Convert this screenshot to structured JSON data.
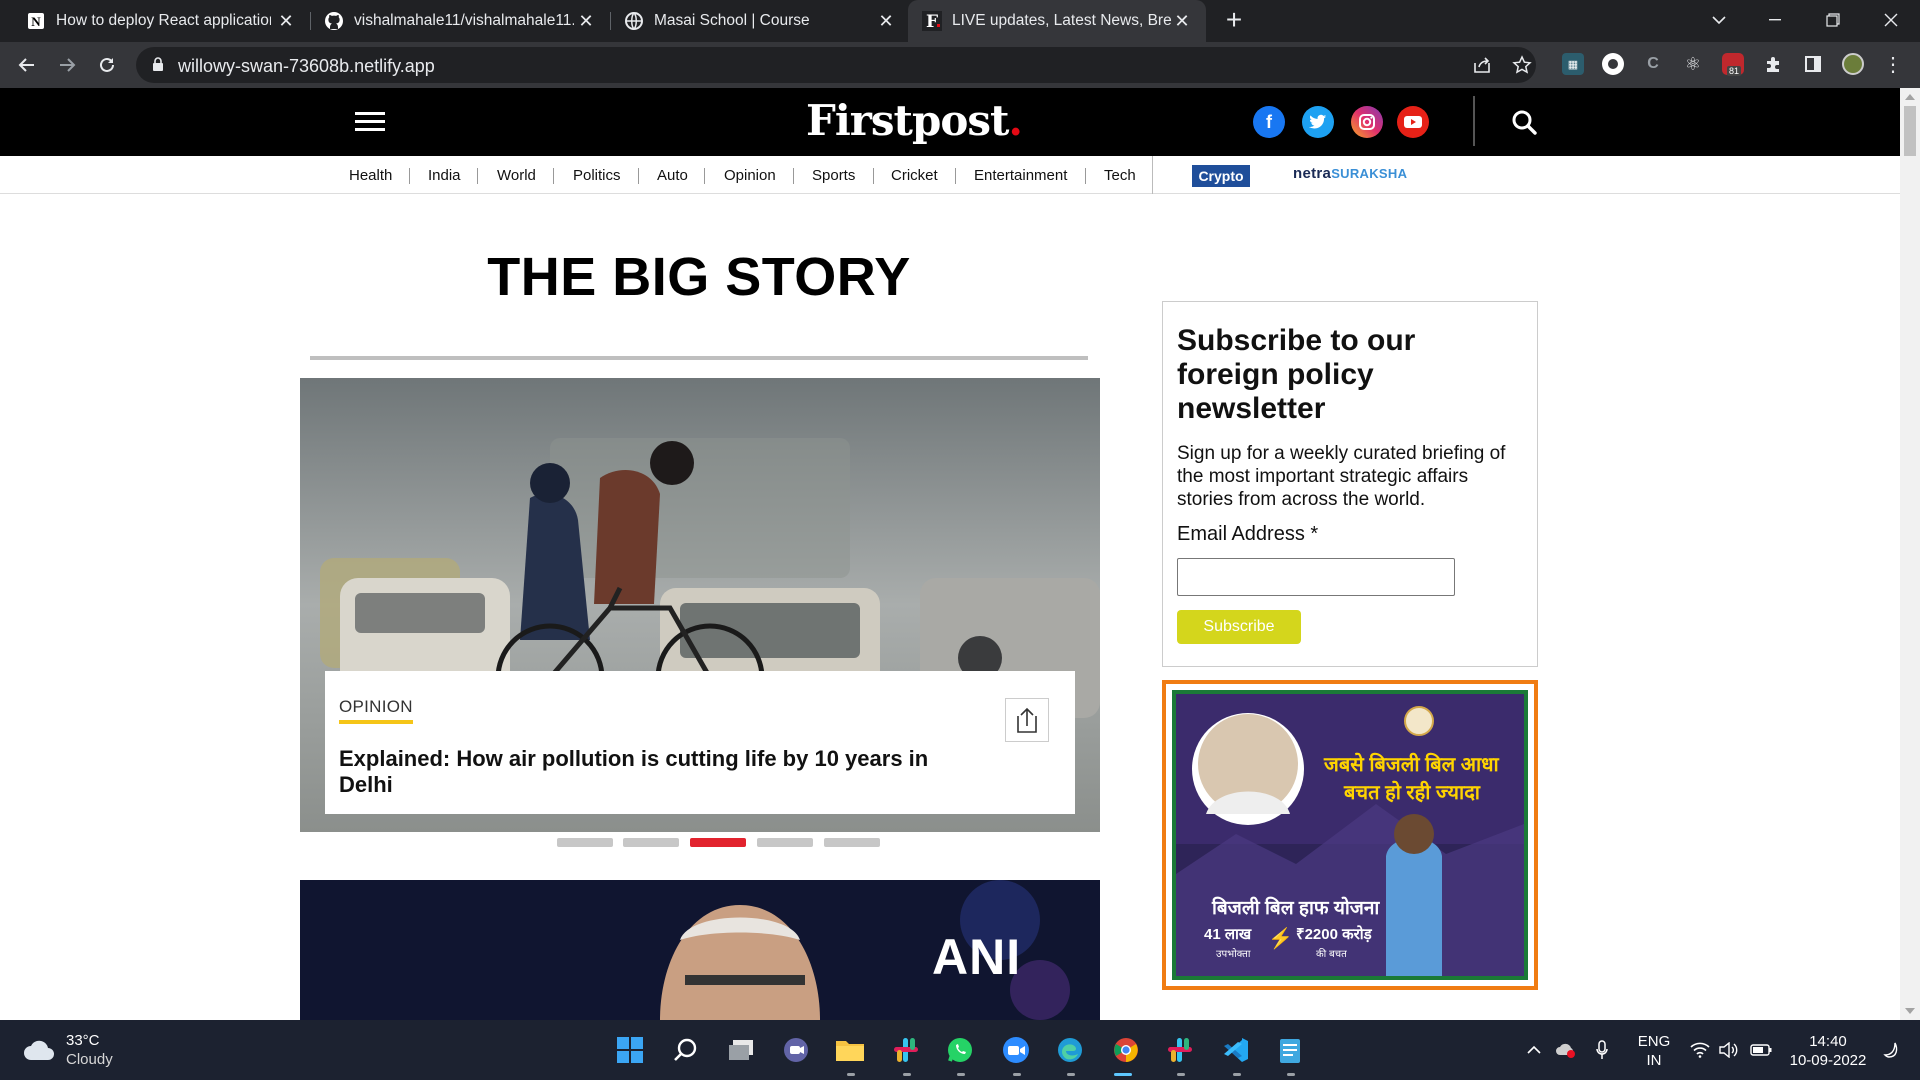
{
  "browser": {
    "tabs": [
      {
        "title": "How to deploy React application",
        "icon": "notion-icon",
        "active": false
      },
      {
        "title": "vishalmahale11/vishalmahale11.g",
        "icon": "github-icon",
        "active": false
      },
      {
        "title": "Masai School | Course",
        "icon": "globe-icon",
        "active": false
      },
      {
        "title": "LIVE updates, Latest News, Break",
        "icon": "firstpost-icon",
        "active": true
      }
    ],
    "url": "willowy-swan-73608b.netlify.app",
    "extension_badge": "81"
  },
  "site": {
    "logo": "Firstpost",
    "logo_dot": ".",
    "social": [
      {
        "name": "facebook",
        "glyph": "f",
        "color": "#1877f2"
      },
      {
        "name": "twitter",
        "glyph": "",
        "color": "#1da1f2"
      },
      {
        "name": "instagram",
        "glyph": "",
        "color": "#e1306c"
      },
      {
        "name": "youtube",
        "glyph": "",
        "color": "#e62117"
      }
    ],
    "categories": [
      "Health",
      "India",
      "World",
      "Politics",
      "Auto",
      "Opinion",
      "Sports",
      "Cricket",
      "Entertainment",
      "Tech"
    ],
    "crypto_label": "Crypto",
    "netra_label": "netra",
    "suraksha_label": "SURAKSHA"
  },
  "big_story": {
    "title": "THE BIG STORY",
    "tag": "OPINION",
    "headline": "Explained: How air pollution is cutting life by 10 years in Delhi",
    "carousel_total": 5,
    "carousel_active": 3,
    "second_image_watermark": "ANI"
  },
  "newsletter": {
    "title": "Subscribe to our foreign policy newsletter",
    "description": "Sign up for a weekly curated briefing of the most important strategic affairs stories from across the world.",
    "email_label": "Email Address *",
    "email_value": "",
    "button_label": "Subscribe"
  },
  "ad": {
    "headline_line1": "जबसे बिजली बिल आधा",
    "headline_line2": "बचत हो रही ज्यादा",
    "scheme": "बिजली बिल हाफ योजना",
    "stat1_value": "41 लाख",
    "stat1_label": "उपभोक्ता",
    "stat2_value": "₹2200 करोड़",
    "stat2_label": "की बचत"
  },
  "taskbar": {
    "temperature": "33°C",
    "weather": "Cloudy",
    "lang_top": "ENG",
    "lang_bottom": "IN",
    "time": "14:40",
    "date": "10-09-2022"
  }
}
